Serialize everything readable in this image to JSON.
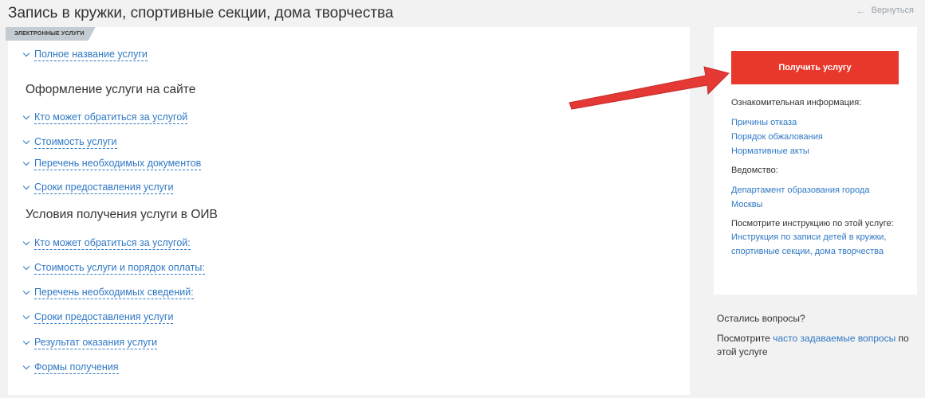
{
  "header": {
    "title": "Запись в кружки, спортивные секции, дома творчества",
    "back_label": "Вернуться"
  },
  "main": {
    "badge": "ЭЛЕКТРОННЫЕ УСЛУГИ",
    "top_item": "Полное название услуги",
    "section1": {
      "title": "Оформление услуги на сайте",
      "items": [
        "Кто может обратиться за услугой",
        "Стоимость услуги",
        "Перечень необходимых документов",
        "Сроки предоставления услуги"
      ]
    },
    "section2": {
      "title": "Условия получения услуги в ОИВ",
      "items": [
        "Кто может обратиться за услугой:",
        "Стоимость услуги и порядок оплаты:",
        "Перечень необходимых сведений:",
        "Сроки предоставления услуги",
        "Результат оказания услуги",
        "Формы получения"
      ]
    }
  },
  "sidebar": {
    "cta_label": "Получить услугу",
    "info_label": "Ознакомительная информация:",
    "info_links": [
      "Причины отказа",
      "Порядок обжалования",
      "Нормативные акты"
    ],
    "dept_label": "Ведомство:",
    "dept_link_1": "Департамент образования города",
    "dept_link_2": "Москвы",
    "instr_label": "Посмотрите инструкцию по этой услуге:",
    "instr_link_1": "Инструкция по записи детей в кружки,",
    "instr_link_2": "спортивные секции, дома творчества"
  },
  "questions": {
    "title": "Остались вопросы?",
    "prefix": "Посмотрите ",
    "link": "часто задаваемые вопросы",
    "suffix_1": " по",
    "suffix_2": "этой услуге"
  },
  "colors": {
    "accent": "#e8382c",
    "link": "#2f78c4"
  }
}
